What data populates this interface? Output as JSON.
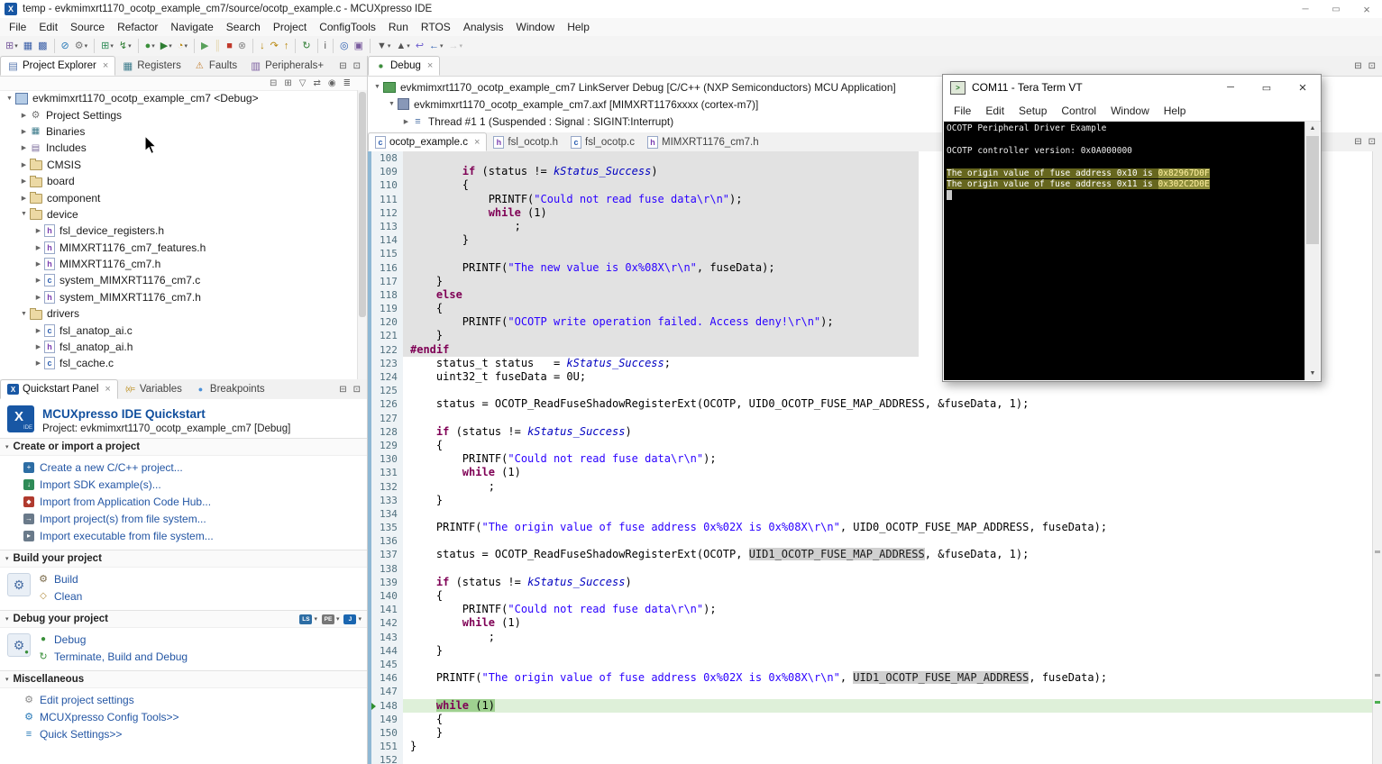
{
  "window": {
    "title": "temp - evkmimxrt1170_ocotp_example_cm7/source/ocotp_example.c - MCUXpresso IDE"
  },
  "menubar": {
    "items": [
      "File",
      "Edit",
      "Source",
      "Refactor",
      "Navigate",
      "Search",
      "Project",
      "ConfigTools",
      "Run",
      "RTOS",
      "Analysis",
      "Window",
      "Help"
    ]
  },
  "toolbar": {
    "items": [
      {
        "name": "new-wizard",
        "glyph": "⊞",
        "color": "#7a5c9e",
        "dd": true
      },
      {
        "name": "save",
        "glyph": "▦",
        "color": "#3a5fa8"
      },
      {
        "name": "save-all",
        "glyph": "▩",
        "color": "#3a5fa8"
      },
      {
        "sep": true
      },
      {
        "name": "skip-all-breakpoints",
        "glyph": "⊘",
        "color": "#2a7ab8"
      },
      {
        "name": "build-all",
        "glyph": "⚙",
        "color": "#777777",
        "dd": true
      },
      {
        "sep": true
      },
      {
        "name": "new-project",
        "glyph": "⊞",
        "color": "#2e8b57",
        "dd": true
      },
      {
        "name": "flash-programmer",
        "glyph": "↯",
        "color": "#2e7d32",
        "dd": true
      },
      {
        "sep": true
      },
      {
        "name": "debug",
        "glyph": "●",
        "color": "#3a8f3a",
        "dd": true
      },
      {
        "name": "run",
        "glyph": "▶",
        "color": "#2e7d32",
        "dd": true
      },
      {
        "name": "profile",
        "glyph": "◔",
        "color": "#b8860b",
        "dd": true
      },
      {
        "sep": true
      },
      {
        "name": "resume",
        "glyph": "▶",
        "color": "#58a05a"
      },
      {
        "name": "suspend",
        "glyph": "║",
        "color": "#caa53d",
        "dim": true
      },
      {
        "name": "terminate",
        "glyph": "■",
        "color": "#c0392b"
      },
      {
        "name": "disconnect",
        "glyph": "⊗",
        "color": "#888888"
      },
      {
        "sep": true
      },
      {
        "name": "step-into",
        "glyph": "↓",
        "color": "#b8860b"
      },
      {
        "name": "step-over",
        "glyph": "↷",
        "color": "#b8860b"
      },
      {
        "name": "step-return",
        "glyph": "↑",
        "color": "#b8860b"
      },
      {
        "sep": true
      },
      {
        "name": "restart",
        "glyph": "↻",
        "color": "#2e7d32"
      },
      {
        "sep": true
      },
      {
        "name": "instruction-stepping",
        "glyph": "i",
        "color": "#555555"
      },
      {
        "sep": true
      },
      {
        "name": "search",
        "glyph": "◎",
        "color": "#2a5db0"
      },
      {
        "name": "open-element",
        "glyph": "▣",
        "color": "#7a5c9e"
      },
      {
        "sep": true
      },
      {
        "name": "next-annotation",
        "glyph": "▼",
        "color": "#555555",
        "dd": true
      },
      {
        "name": "previous-annotation",
        "glyph": "▲",
        "color": "#555555",
        "dd": true
      },
      {
        "name": "last-edit-location",
        "glyph": "↩",
        "color": "#6a5acd"
      },
      {
        "name": "back",
        "glyph": "←",
        "color": "#2a5db0",
        "dd": true
      },
      {
        "name": "forward",
        "glyph": "→",
        "color": "#999999",
        "dd": true,
        "dim": true
      }
    ]
  },
  "explorer": {
    "tabs": [
      {
        "label": "Project Explorer",
        "icon": "project-explorer-icon",
        "active": true,
        "close": true
      },
      {
        "label": "Registers",
        "icon": "registers-icon"
      },
      {
        "label": "Faults",
        "icon": "faults-icon"
      },
      {
        "label": "Peripherals+",
        "icon": "peripherals-icon"
      }
    ],
    "tools": [
      {
        "name": "collapse-all",
        "glyph": "⊟"
      },
      {
        "name": "expand-all",
        "glyph": "⊞"
      },
      {
        "name": "filter",
        "glyph": "▽"
      },
      {
        "name": "link-with-editor",
        "glyph": "⇄"
      },
      {
        "name": "focus-on-active-task",
        "glyph": "◉"
      },
      {
        "name": "view-menu",
        "glyph": "≣"
      }
    ],
    "tree": [
      {
        "level": 0,
        "exp": "open",
        "icon": "project-icon",
        "label": "evkmimxrt1170_ocotp_example_cm7 <Debug>"
      },
      {
        "level": 1,
        "exp": "closed",
        "icon": "settings-icon",
        "label": "Project Settings"
      },
      {
        "level": 1,
        "exp": "closed",
        "icon": "binaries-icon",
        "label": "Binaries"
      },
      {
        "level": 1,
        "exp": "closed",
        "icon": "includes-icon",
        "label": "Includes"
      },
      {
        "level": 1,
        "exp": "closed",
        "icon": "folder-icon",
        "label": "CMSIS"
      },
      {
        "level": 1,
        "exp": "closed",
        "icon": "folder-icon",
        "label": "board"
      },
      {
        "level": 1,
        "exp": "closed",
        "icon": "folder-icon",
        "label": "component"
      },
      {
        "level": 1,
        "exp": "open",
        "icon": "folder-icon",
        "label": "device"
      },
      {
        "level": 2,
        "exp": "closed",
        "icon": "h-file-icon",
        "label": "fsl_device_registers.h"
      },
      {
        "level": 2,
        "exp": "closed",
        "icon": "h-file-icon",
        "label": "MIMXRT1176_cm7_features.h"
      },
      {
        "level": 2,
        "exp": "closed",
        "icon": "h-file-icon",
        "label": "MIMXRT1176_cm7.h"
      },
      {
        "level": 2,
        "exp": "closed",
        "icon": "c-file-icon",
        "label": "system_MIMXRT1176_cm7.c"
      },
      {
        "level": 2,
        "exp": "closed",
        "icon": "h-file-icon",
        "label": "system_MIMXRT1176_cm7.h"
      },
      {
        "level": 1,
        "exp": "open",
        "icon": "folder-icon",
        "label": "drivers"
      },
      {
        "level": 2,
        "exp": "closed",
        "icon": "c-file-icon",
        "label": "fsl_anatop_ai.c"
      },
      {
        "level": 2,
        "exp": "closed",
        "icon": "h-file-icon",
        "label": "fsl_anatop_ai.h"
      },
      {
        "level": 2,
        "exp": "closed",
        "icon": "c-file-icon",
        "label": "fsl_cache.c"
      }
    ]
  },
  "quickstart": {
    "tabs": [
      {
        "label": "Quickstart Panel",
        "icon": "quickstart-icon",
        "active": true,
        "close": true
      },
      {
        "label": "Variables",
        "icon": "variables-icon"
      },
      {
        "label": "Breakpoints",
        "icon": "breakpoints-icon"
      }
    ],
    "title": "MCUXpresso IDE Quickstart",
    "subtitle": "Project: evkmimxrt1170_ocotp_example_cm7 [Debug]",
    "sections": [
      {
        "title": "Create or import a project",
        "items": [
          {
            "label": "Create a new C/C++ project...",
            "icon": "new-project-link-icon"
          },
          {
            "label": "Import SDK example(s)...",
            "icon": "import-sdk-link-icon"
          },
          {
            "label": "Import from Application Code Hub...",
            "icon": "app-code-hub-link-icon"
          },
          {
            "label": "Import project(s) from file system...",
            "icon": "import-fs-link-icon"
          },
          {
            "label": "Import executable from file system...",
            "icon": "import-exe-link-icon"
          }
        ]
      },
      {
        "title": "Build your project",
        "big": "build-big",
        "items": [
          {
            "label": "Build",
            "icon": "build-link-icon"
          },
          {
            "label": "Clean",
            "icon": "clean-link-icon"
          }
        ]
      },
      {
        "title": "Debug your project",
        "big": "debug-big",
        "probes": [
          {
            "name": "linkserver-probe",
            "label": "LS"
          },
          {
            "name": "pemicro-probe",
            "label": "PE"
          },
          {
            "name": "jlink-probe",
            "label": "J"
          }
        ],
        "items": [
          {
            "label": "Debug",
            "icon": "debug-link-icon"
          },
          {
            "label": "Terminate, Build and Debug",
            "icon": "tbd-link-icon"
          }
        ]
      },
      {
        "title": "Miscellaneous",
        "items": [
          {
            "label": "Edit project settings",
            "icon": "edit-settings-link-icon"
          },
          {
            "label": "MCUXpresso Config Tools>>",
            "icon": "config-tools-link-icon"
          },
          {
            "label": "Quick Settings>>",
            "icon": "quick-settings-link-icon"
          }
        ]
      }
    ]
  },
  "debug_view": {
    "tabs": [
      {
        "label": "Debug",
        "icon": "debug-icon",
        "active": true,
        "close": true
      }
    ],
    "tree": [
      {
        "level": 0,
        "exp": "open",
        "icon": "debug-target-icon",
        "label": "evkmimxrt1170_ocotp_example_cm7 LinkServer Debug [C/C++ (NXP Semiconductors) MCU Application]"
      },
      {
        "level": 1,
        "exp": "open",
        "icon": "program-icon",
        "label": "evkmimxrt1170_ocotp_example_cm7.axf [MIMXRT1176xxxx (cortex-m7)]"
      },
      {
        "level": 2,
        "exp": "closed",
        "icon": "thread-icon",
        "label": "Thread #1 1 (Suspended : Signal : SIGINT:Interrupt)"
      }
    ]
  },
  "editor": {
    "tabs": [
      {
        "label": "ocotp_example.c",
        "icon": "c-file-icon",
        "active": true,
        "close": true
      },
      {
        "label": "fsl_ocotp.h",
        "icon": "h-file-icon"
      },
      {
        "label": "fsl_ocotp.c",
        "icon": "c-file-icon"
      },
      {
        "label": "MIMXRT1176_cm7.h",
        "icon": "h-file-icon"
      }
    ],
    "inactive": {
      "from": 108,
      "to": 122
    },
    "current_line": 148,
    "lines": [
      {
        "n": 108,
        "seg": []
      },
      {
        "n": 109,
        "seg": [
          [
            "p",
            "        "
          ],
          [
            "k",
            "if"
          ],
          [
            "p",
            " (status != "
          ],
          [
            "e",
            "kStatus_Success"
          ],
          [
            "p",
            ")"
          ]
        ]
      },
      {
        "n": 110,
        "seg": [
          [
            "p",
            "        {"
          ]
        ]
      },
      {
        "n": 111,
        "seg": [
          [
            "p",
            "            PRINTF("
          ],
          [
            "s",
            "\"Could not read fuse data\\r\\n\""
          ],
          [
            "p",
            ");"
          ]
        ]
      },
      {
        "n": 112,
        "seg": [
          [
            "p",
            "            "
          ],
          [
            "k",
            "while"
          ],
          [
            "p",
            " (1)"
          ]
        ]
      },
      {
        "n": 113,
        "seg": [
          [
            "p",
            "                ;"
          ]
        ]
      },
      {
        "n": 114,
        "seg": [
          [
            "p",
            "        }"
          ]
        ]
      },
      {
        "n": 115,
        "seg": []
      },
      {
        "n": 116,
        "seg": [
          [
            "p",
            "        PRINTF("
          ],
          [
            "s",
            "\"The new value is 0x%08X\\r\\n\""
          ],
          [
            "p",
            ", fuseData);"
          ]
        ]
      },
      {
        "n": 117,
        "seg": [
          [
            "p",
            "    }"
          ]
        ]
      },
      {
        "n": 118,
        "seg": [
          [
            "p",
            "    "
          ],
          [
            "k",
            "else"
          ]
        ]
      },
      {
        "n": 119,
        "seg": [
          [
            "p",
            "    {"
          ]
        ]
      },
      {
        "n": 120,
        "seg": [
          [
            "p",
            "        PRINTF("
          ],
          [
            "s",
            "\"OCOTP write operation failed. Access deny!\\r\\n\""
          ],
          [
            "p",
            ");"
          ]
        ]
      },
      {
        "n": 121,
        "seg": [
          [
            "p",
            "    }"
          ]
        ]
      },
      {
        "n": 122,
        "seg": [
          [
            "d",
            "#endif"
          ]
        ]
      },
      {
        "n": 123,
        "seg": [
          [
            "p",
            "    status_t status   = "
          ],
          [
            "e",
            "kStatus_Success"
          ],
          [
            "p",
            ";"
          ]
        ]
      },
      {
        "n": 124,
        "seg": [
          [
            "p",
            "    uint32_t fuseData = 0U;"
          ]
        ]
      },
      {
        "n": 125,
        "seg": []
      },
      {
        "n": 126,
        "seg": [
          [
            "p",
            "    status = OCOTP_ReadFuseShadowRegisterExt(OCOTP, UID0_OCOTP_FUSE_MAP_ADDRESS, &fuseData, 1);"
          ]
        ]
      },
      {
        "n": 127,
        "seg": []
      },
      {
        "n": 128,
        "seg": [
          [
            "p",
            "    "
          ],
          [
            "k",
            "if"
          ],
          [
            "p",
            " (status != "
          ],
          [
            "e",
            "kStatus_Success"
          ],
          [
            "p",
            ")"
          ]
        ]
      },
      {
        "n": 129,
        "seg": [
          [
            "p",
            "    {"
          ]
        ]
      },
      {
        "n": 130,
        "seg": [
          [
            "p",
            "        PRINTF("
          ],
          [
            "s",
            "\"Could not read fuse data\\r\\n\""
          ],
          [
            "p",
            ");"
          ]
        ]
      },
      {
        "n": 131,
        "seg": [
          [
            "p",
            "        "
          ],
          [
            "k",
            "while"
          ],
          [
            "p",
            " (1)"
          ]
        ]
      },
      {
        "n": 132,
        "seg": [
          [
            "p",
            "            ;"
          ]
        ]
      },
      {
        "n": 133,
        "seg": [
          [
            "p",
            "    }"
          ]
        ]
      },
      {
        "n": 134,
        "seg": []
      },
      {
        "n": 135,
        "seg": [
          [
            "p",
            "    PRINTF("
          ],
          [
            "s",
            "\"The origin value of fuse address 0x%02X is 0x%08X\\r\\n\""
          ],
          [
            "p",
            ", UID0_OCOTP_FUSE_MAP_ADDRESS, fuseData);"
          ]
        ]
      },
      {
        "n": 136,
        "seg": []
      },
      {
        "n": 137,
        "seg": [
          [
            "p",
            "    status = OCOTP_ReadFuseShadowRegisterExt(OCOTP, "
          ],
          [
            "hl",
            "UID1_OCOTP_FUSE_MAP_ADDRESS"
          ],
          [
            "p",
            ", &fuseData, 1);"
          ]
        ]
      },
      {
        "n": 138,
        "seg": []
      },
      {
        "n": 139,
        "seg": [
          [
            "p",
            "    "
          ],
          [
            "k",
            "if"
          ],
          [
            "p",
            " (status != "
          ],
          [
            "e",
            "kStatus_Success"
          ],
          [
            "p",
            ")"
          ]
        ]
      },
      {
        "n": 140,
        "seg": [
          [
            "p",
            "    {"
          ]
        ]
      },
      {
        "n": 141,
        "seg": [
          [
            "p",
            "        PRINTF("
          ],
          [
            "s",
            "\"Could not read fuse data\\r\\n\""
          ],
          [
            "p",
            ");"
          ]
        ]
      },
      {
        "n": 142,
        "seg": [
          [
            "p",
            "        "
          ],
          [
            "k",
            "while"
          ],
          [
            "p",
            " (1)"
          ]
        ]
      },
      {
        "n": 143,
        "seg": [
          [
            "p",
            "            ;"
          ]
        ]
      },
      {
        "n": 144,
        "seg": [
          [
            "p",
            "    }"
          ]
        ]
      },
      {
        "n": 145,
        "seg": []
      },
      {
        "n": 146,
        "seg": [
          [
            "p",
            "    PRINTF("
          ],
          [
            "s",
            "\"The origin value of fuse address 0x%02X is 0x%08X\\r\\n\""
          ],
          [
            "p",
            ", "
          ],
          [
            "hl",
            "UID1_OCOTP_FUSE_MAP_ADDRESS"
          ],
          [
            "p",
            ", fuseData);"
          ]
        ]
      },
      {
        "n": 147,
        "seg": []
      },
      {
        "n": 148,
        "seg": [
          [
            "p",
            "    "
          ],
          [
            "k",
            "while"
          ],
          [
            "p",
            " (1)"
          ]
        ]
      },
      {
        "n": 149,
        "seg": [
          [
            "p",
            "    {"
          ]
        ]
      },
      {
        "n": 150,
        "seg": [
          [
            "p",
            "    }"
          ]
        ]
      },
      {
        "n": 151,
        "seg": [
          [
            "p",
            "}"
          ]
        ]
      },
      {
        "n": 152,
        "seg": []
      }
    ]
  },
  "teraterm": {
    "title": "COM11 - Tera Term VT",
    "menu": [
      "File",
      "Edit",
      "Setup",
      "Control",
      "Window",
      "Help"
    ],
    "terminal_lines": [
      {
        "seg": [
          [
            "t",
            "OCOTP Peripheral Driver Example"
          ]
        ]
      },
      {
        "seg": []
      },
      {
        "seg": [
          [
            "t",
            "OCOTP controller version: 0x0A000000"
          ]
        ]
      },
      {
        "seg": []
      },
      {
        "seg": [
          [
            "sel",
            "The origin value of fuse address 0x10 is "
          ],
          [
            "selx",
            "0x82967D0F"
          ]
        ]
      },
      {
        "seg": [
          [
            "sel",
            "The origin value of fuse address 0x11 is "
          ],
          [
            "selx",
            "0x302C2D0E"
          ]
        ]
      },
      {
        "seg": [
          [
            "cursor",
            " "
          ]
        ]
      }
    ]
  },
  "colors": {
    "accent_blue": "#12509e",
    "keyword": "#7f0055",
    "string": "#2a00ff",
    "inactive_code_bg": "#e2e2e2",
    "current_line_bg": "#9fd190",
    "terminal_selection": "#66661e"
  }
}
